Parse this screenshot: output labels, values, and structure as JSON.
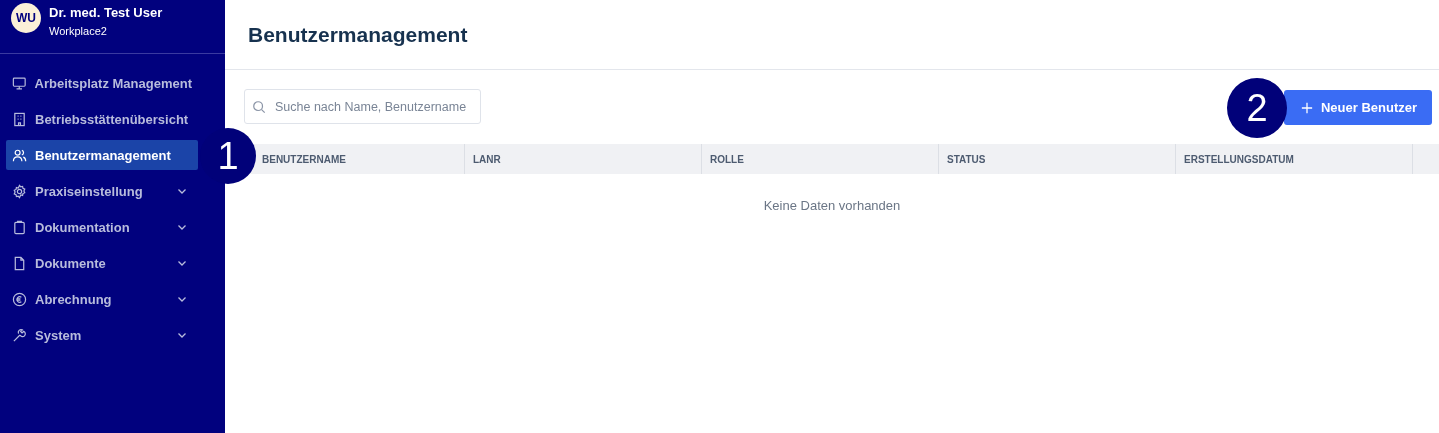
{
  "user": {
    "initials": "WU",
    "name": "Dr. med. Test User",
    "workplace": "Workplace2"
  },
  "sidebar": {
    "items": [
      {
        "label": "Arbeitsplatz Management",
        "selected": false
      },
      {
        "label": "Betriebsstättenübersicht",
        "selected": false
      },
      {
        "label": "Benutzermanagement",
        "selected": true
      },
      {
        "label": "Praxiseinstellung",
        "selected": false,
        "expanded": false
      },
      {
        "label": "Dokumentation",
        "selected": false,
        "expanded": false
      },
      {
        "label": "Dokumente",
        "selected": false,
        "expanded": false
      },
      {
        "label": "Abrechnung",
        "selected": false,
        "expanded": false
      },
      {
        "label": "System",
        "selected": false,
        "expanded": false
      }
    ]
  },
  "page": {
    "title": "Benutzermanagement"
  },
  "search": {
    "placeholder": "Suche nach Name, Benutzername"
  },
  "new_button": {
    "label": "Neuer Benutzer"
  },
  "table": {
    "columns": [
      "BENUTZERNAME",
      "LANR",
      "ROLLE",
      "STATUS",
      "ERSTELLUNGSDATUM"
    ],
    "empty_text": "Keine Daten vorhanden"
  },
  "callouts": [
    "1",
    "2"
  ]
}
